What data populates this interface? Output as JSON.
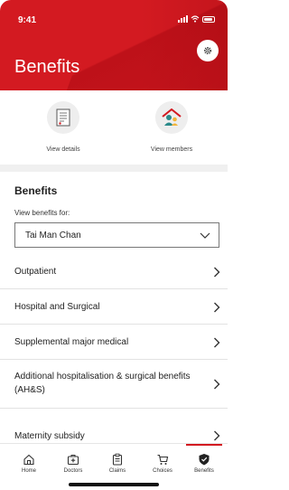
{
  "status_bar": {
    "time": "9:41"
  },
  "header": {
    "title": "Benefits"
  },
  "quick_actions": {
    "view_details": "View details",
    "view_members": "View members"
  },
  "benefits": {
    "section_title": "Benefits",
    "view_for_label": "View benefits for:",
    "selected_member": "Tai Man Chan"
  },
  "list": {
    "items": [
      {
        "label": "Outpatient"
      },
      {
        "label": "Hospital and Surgical"
      },
      {
        "label": "Supplemental major medical"
      },
      {
        "label": "Additional hospitalisation & surgical benefits (AH&S)"
      },
      {
        "label": "Maternity subsidy"
      }
    ]
  },
  "tabbar": {
    "tabs": [
      {
        "label": "Home"
      },
      {
        "label": "Doctors"
      },
      {
        "label": "Claims"
      },
      {
        "label": "Choices"
      },
      {
        "label": "Benefits"
      }
    ],
    "active": "Benefits"
  },
  "colors": {
    "brand_red": "#d31a21",
    "divider_gray": "#f0f0f0",
    "icon_circle": "#eeeeee"
  }
}
